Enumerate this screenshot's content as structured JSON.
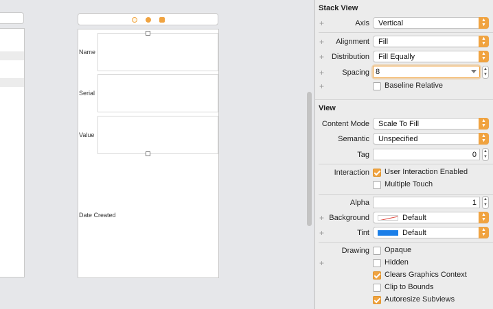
{
  "canvas": {
    "fields": [
      {
        "label": "Name"
      },
      {
        "label": "Serial"
      },
      {
        "label": "Value"
      },
      {
        "label": "Date Created"
      }
    ]
  },
  "inspector": {
    "stack_view": {
      "title": "Stack View",
      "axis": {
        "label": "Axis",
        "value": "Vertical"
      },
      "alignment": {
        "label": "Alignment",
        "value": "Fill"
      },
      "distribution": {
        "label": "Distribution",
        "value": "Fill Equally"
      },
      "spacing": {
        "label": "Spacing",
        "value": "8"
      },
      "baseline_relative": {
        "label": "Baseline Relative",
        "checked": false
      }
    },
    "view": {
      "title": "View",
      "content_mode": {
        "label": "Content Mode",
        "value": "Scale To Fill"
      },
      "semantic": {
        "label": "Semantic",
        "value": "Unspecified"
      },
      "tag": {
        "label": "Tag",
        "value": "0"
      },
      "interaction": {
        "label": "Interaction",
        "user_interaction": {
          "label": "User Interaction Enabled",
          "checked": true
        },
        "multiple_touch": {
          "label": "Multiple Touch",
          "checked": false
        }
      },
      "alpha": {
        "label": "Alpha",
        "value": "1"
      },
      "background": {
        "label": "Background",
        "value": "Default",
        "swatch": "none"
      },
      "tint": {
        "label": "Tint",
        "value": "Default",
        "swatch": "#1a7ee8"
      },
      "drawing": {
        "label": "Drawing",
        "opaque": {
          "label": "Opaque",
          "checked": false
        },
        "hidden": {
          "label": "Hidden",
          "checked": false
        },
        "clears_graphics_context": {
          "label": "Clears Graphics Context",
          "checked": true
        },
        "clip_to_bounds": {
          "label": "Clip to Bounds",
          "checked": false
        },
        "autoresize_subviews": {
          "label": "Autoresize Subviews",
          "checked": true
        }
      }
    }
  },
  "colors": {
    "accent": "#f0a340",
    "tint_blue": "#1a7ee8"
  }
}
